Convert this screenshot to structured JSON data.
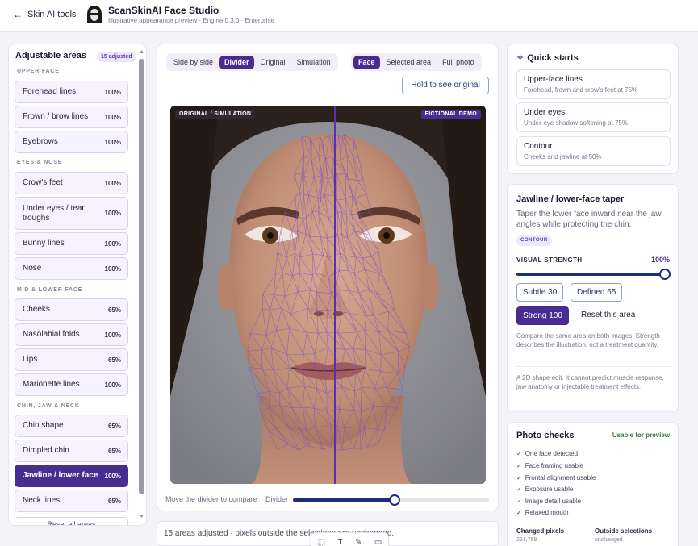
{
  "header": {
    "back_label": "Skin AI tools",
    "app_title": "ScanSkinAI Face Studio",
    "app_subtitle": "Illustrative appearance preview · Engine 0.3.0 · Enterprise"
  },
  "left_panel": {
    "title": "Adjustable areas",
    "badge": "15 adjusted",
    "sections": [
      {
        "label": "UPPER FACE",
        "items": [
          {
            "name": "Forehead lines",
            "value": "100%"
          },
          {
            "name": "Frown / brow lines",
            "value": "100%"
          },
          {
            "name": "Eyebrows",
            "value": "100%"
          }
        ]
      },
      {
        "label": "EYES & NOSE",
        "items": [
          {
            "name": "Crow's feet",
            "value": "100%"
          },
          {
            "name": "Under eyes / tear troughs",
            "value": "100%"
          },
          {
            "name": "Bunny lines",
            "value": "100%"
          },
          {
            "name": "Nose",
            "value": "100%"
          }
        ]
      },
      {
        "label": "MID & LOWER FACE",
        "items": [
          {
            "name": "Cheeks",
            "value": "65%"
          },
          {
            "name": "Nasolabial folds",
            "value": "100%"
          },
          {
            "name": "Lips",
            "value": "65%"
          },
          {
            "name": "Marionette lines",
            "value": "100%"
          }
        ]
      },
      {
        "label": "CHIN, JAW & NECK",
        "items": [
          {
            "name": "Chin shape",
            "value": "65%"
          },
          {
            "name": "Dimpled chin",
            "value": "65%"
          },
          {
            "name": "Jawline / lower face",
            "value": "100%"
          },
          {
            "name": "Neck lines",
            "value": "65%"
          }
        ]
      }
    ],
    "reset_all": "Reset all areas"
  },
  "viewer": {
    "view_modes": [
      "Side by side",
      "Divider",
      "Original",
      "Simulation"
    ],
    "active_view_mode": "Divider",
    "scope_modes": [
      "Face",
      "Selected area",
      "Full photo"
    ],
    "active_scope_mode": "Face",
    "hold_button": "Hold to see original",
    "tag_left": "ORIGINAL / SIMULATION",
    "tag_right": "FICTIONAL DEMO",
    "compare_hint": "Move the divider to compare",
    "divider_label": "Divider",
    "divider_position": 0.52
  },
  "status_bar": {
    "text": "15 areas adjusted · pixels outside the selections are unchanged."
  },
  "toolbar_icons": [
    "select-icon",
    "text-icon",
    "pen-icon",
    "shape-icon"
  ],
  "quick_starts": {
    "title": "Quick starts",
    "items": [
      {
        "name": "Upper-face lines",
        "desc": "Forehead, frown and crow's feet at 75%"
      },
      {
        "name": "Under eyes",
        "desc": "Under-eye shadow softening at 75%"
      },
      {
        "name": "Contour",
        "desc": "Cheeks and jawline at 50%"
      }
    ]
  },
  "area_detail": {
    "title": "Jawline / lower-face taper",
    "description": "Taper the lower face inward near the jaw angles while protecting the chin.",
    "tag": "CONTOUR",
    "strength_label": "VISUAL STRENGTH",
    "strength_value": "100%",
    "strength_level": 1.0,
    "presets": [
      "Subtle 30",
      "Defined 65",
      "Strong 100"
    ],
    "active_preset": "Strong 100",
    "reset_label": "Reset this area",
    "note1": "Compare the same area on both images. Strength describes the illustration, not a treatment quantity.",
    "note2": "A 2D shape edit. It cannot predict muscle response, jaw anatomy or injectable treatment effects."
  },
  "photo_checks": {
    "title": "Photo checks",
    "status": "Usable for preview",
    "items": [
      "One face detected",
      "Face framing usable",
      "Frontal alignment usable",
      "Exposure usable",
      "Image detail usable",
      "Relaxed mouth"
    ],
    "stats": [
      {
        "label": "Changed pixels",
        "value": "251,759"
      },
      {
        "label": "Outside selections",
        "value": "unchanged"
      }
    ]
  },
  "colors": {
    "accent": "#4a2b8f",
    "slider": "#1d2f7a",
    "mesh": "#7a4fc8",
    "ok": "#2b7a4b"
  }
}
